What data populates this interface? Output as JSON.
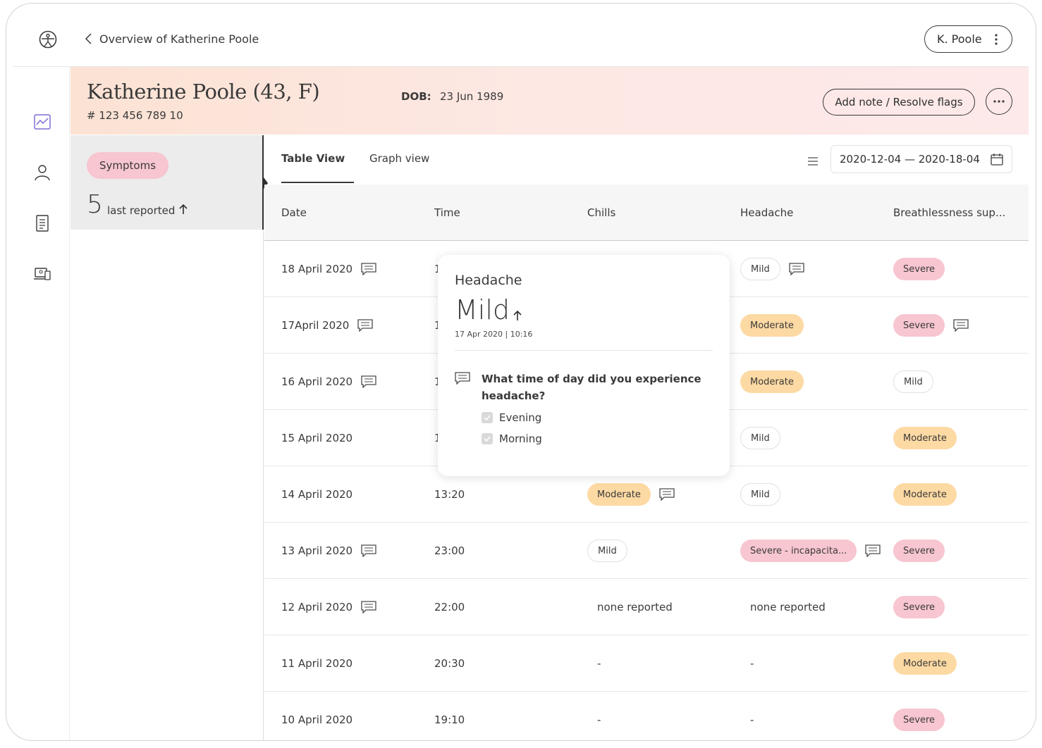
{
  "header": {
    "breadcrumb": "Overview of Katherine Poole",
    "user_label": "K. Poole"
  },
  "patient": {
    "name": "Katherine Poole (43, F)",
    "id": "# 123 456 789 10",
    "dob_label": "DOB:",
    "dob_value": "23 Jun 1989",
    "add_note_label": "Add note / Resolve flags"
  },
  "category": {
    "label": "Symptoms",
    "count": "5",
    "count_label": "last reported"
  },
  "tabs": [
    "Table View",
    "Graph view"
  ],
  "date_range": "2020-12-04 — 2020-18-04",
  "table": {
    "headers": [
      "Date",
      "Time",
      "Chills",
      "Headache",
      "Breathlessness sup..."
    ],
    "rows": [
      {
        "date": "18 April 2020",
        "time": "1",
        "chills": "",
        "headache": "Mild",
        "breath": "Severe"
      },
      {
        "date": "17April 2020",
        "time": "1",
        "chills": "",
        "headache": "Moderate",
        "breath": "Severe"
      },
      {
        "date": "16 April 2020",
        "time": "1",
        "chills": "",
        "headache": "Moderate",
        "breath": "Mild"
      },
      {
        "date": "15 April 2020",
        "time": "1",
        "chills": "",
        "headache": "Mild",
        "breath": "Moderate"
      },
      {
        "date": "14 April 2020",
        "time": "13:20",
        "chills": "Moderate",
        "headache": "Mild",
        "breath": "Moderate"
      },
      {
        "date": "13 April 2020",
        "time": "23:00",
        "chills": "Mild",
        "headache": "Severe - incapacita...",
        "breath": "Severe"
      },
      {
        "date": "12 April 2020",
        "time": "22:00",
        "chills": "none reported",
        "headache": "none reported",
        "breath": "Severe"
      },
      {
        "date": "11 April 2020",
        "time": "20:30",
        "chills": "-",
        "headache": "-",
        "breath": "Moderate"
      },
      {
        "date": "10 April 2020",
        "time": "19:10",
        "chills": "-",
        "headache": "-",
        "breath": "Severe"
      }
    ]
  },
  "popover": {
    "title": "Headache",
    "value": "Mild",
    "timestamp": "17 Apr 2020 | 10:16",
    "question": "What time of day did you experience headache?",
    "options": [
      "Evening",
      "Morning"
    ]
  },
  "colors": {
    "mild_pill_border": "#e0e0e0",
    "moderate_pill": "#fdd9a3",
    "severe_pill": "#f7c6d0",
    "accent_icon": "#7b6fd6"
  }
}
